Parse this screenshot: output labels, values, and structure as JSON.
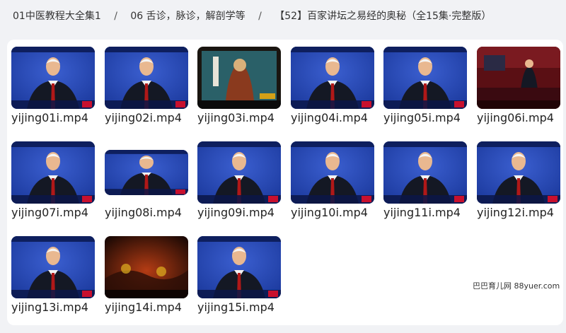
{
  "breadcrumb": {
    "items": [
      "01中医教程大全集1",
      "06 舌诊，脉诊，解剖学等",
      "【52】百家讲坛之易经的奥秘（全15集·完整版）"
    ],
    "separator": "/"
  },
  "files": [
    {
      "name": "yijing01i.mp4",
      "scene": "speaker"
    },
    {
      "name": "yijing02i.mp4",
      "scene": "speaker"
    },
    {
      "name": "yijing03i.mp4",
      "scene": "painting"
    },
    {
      "name": "yijing04i.mp4",
      "scene": "speaker"
    },
    {
      "name": "yijing05i.mp4",
      "scene": "speaker"
    },
    {
      "name": "yijing06i.mp4",
      "scene": "stage"
    },
    {
      "name": "yijing07i.mp4",
      "scene": "speaker"
    },
    {
      "name": "yijing08i.mp4",
      "scene": "speaker-wide"
    },
    {
      "name": "yijing09i.mp4",
      "scene": "speaker"
    },
    {
      "name": "yijing10i.mp4",
      "scene": "speaker"
    },
    {
      "name": "yijing11i.mp4",
      "scene": "speaker"
    },
    {
      "name": "yijing12i.mp4",
      "scene": "speaker"
    },
    {
      "name": "yijing13i.mp4",
      "scene": "speaker"
    },
    {
      "name": "yijing14i.mp4",
      "scene": "title-card"
    },
    {
      "name": "yijing15i.mp4",
      "scene": "speaker"
    }
  ],
  "icons": {
    "thumbnail": "video-thumbnail-icon"
  },
  "colors": {
    "page_bg": "#f1f2f5",
    "panel_bg": "#ffffff",
    "studio_blue": "#1c3a9e",
    "suit": "#141824",
    "tie": "#b01818"
  },
  "watermark": "巴巴育儿网 88yuer.com"
}
